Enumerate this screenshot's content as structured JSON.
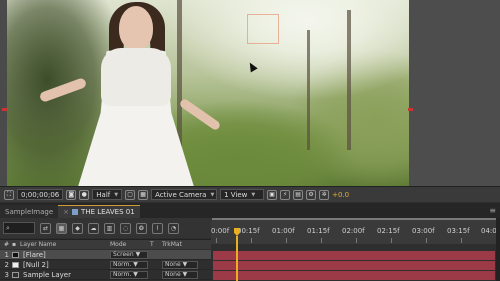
{
  "viewer": {
    "zoom_readout": "0;00;00;06",
    "resolution": "Half",
    "view": "Active Camera",
    "view_layout": "1 View",
    "exposure": "+0.0"
  },
  "tabs": [
    {
      "label": "SampleImage"
    },
    {
      "label": "THE LEAVES 01"
    }
  ],
  "timeline": {
    "search_icon_glyph": "⌕",
    "ruler": [
      "0:00f",
      "00:15f",
      "01:00f",
      "01:15f",
      "02:00f",
      "02:15f",
      "03:00f",
      "03:15f",
      "04:0"
    ]
  },
  "columns": {
    "num": "#",
    "layer_name": "Layer Name",
    "mode": "Mode",
    "t": "T",
    "trkmat": "TrkMat"
  },
  "layers": [
    {
      "num": "1",
      "name": "[Flare]",
      "mode": "Screen",
      "trkmat": "",
      "color": "#9c3a48"
    },
    {
      "num": "2",
      "name": "[Null 2]",
      "mode": "Norm.",
      "trkmat": "None",
      "color": "#9c3a48"
    },
    {
      "num": "3",
      "name": "Sample Layer",
      "mode": "Norm.",
      "trkmat": "None",
      "color": "#9c3a48"
    }
  ],
  "colors": {
    "accent": "#e8b020",
    "track": "#9c3a48",
    "tab_accent": "#d09a3a"
  }
}
